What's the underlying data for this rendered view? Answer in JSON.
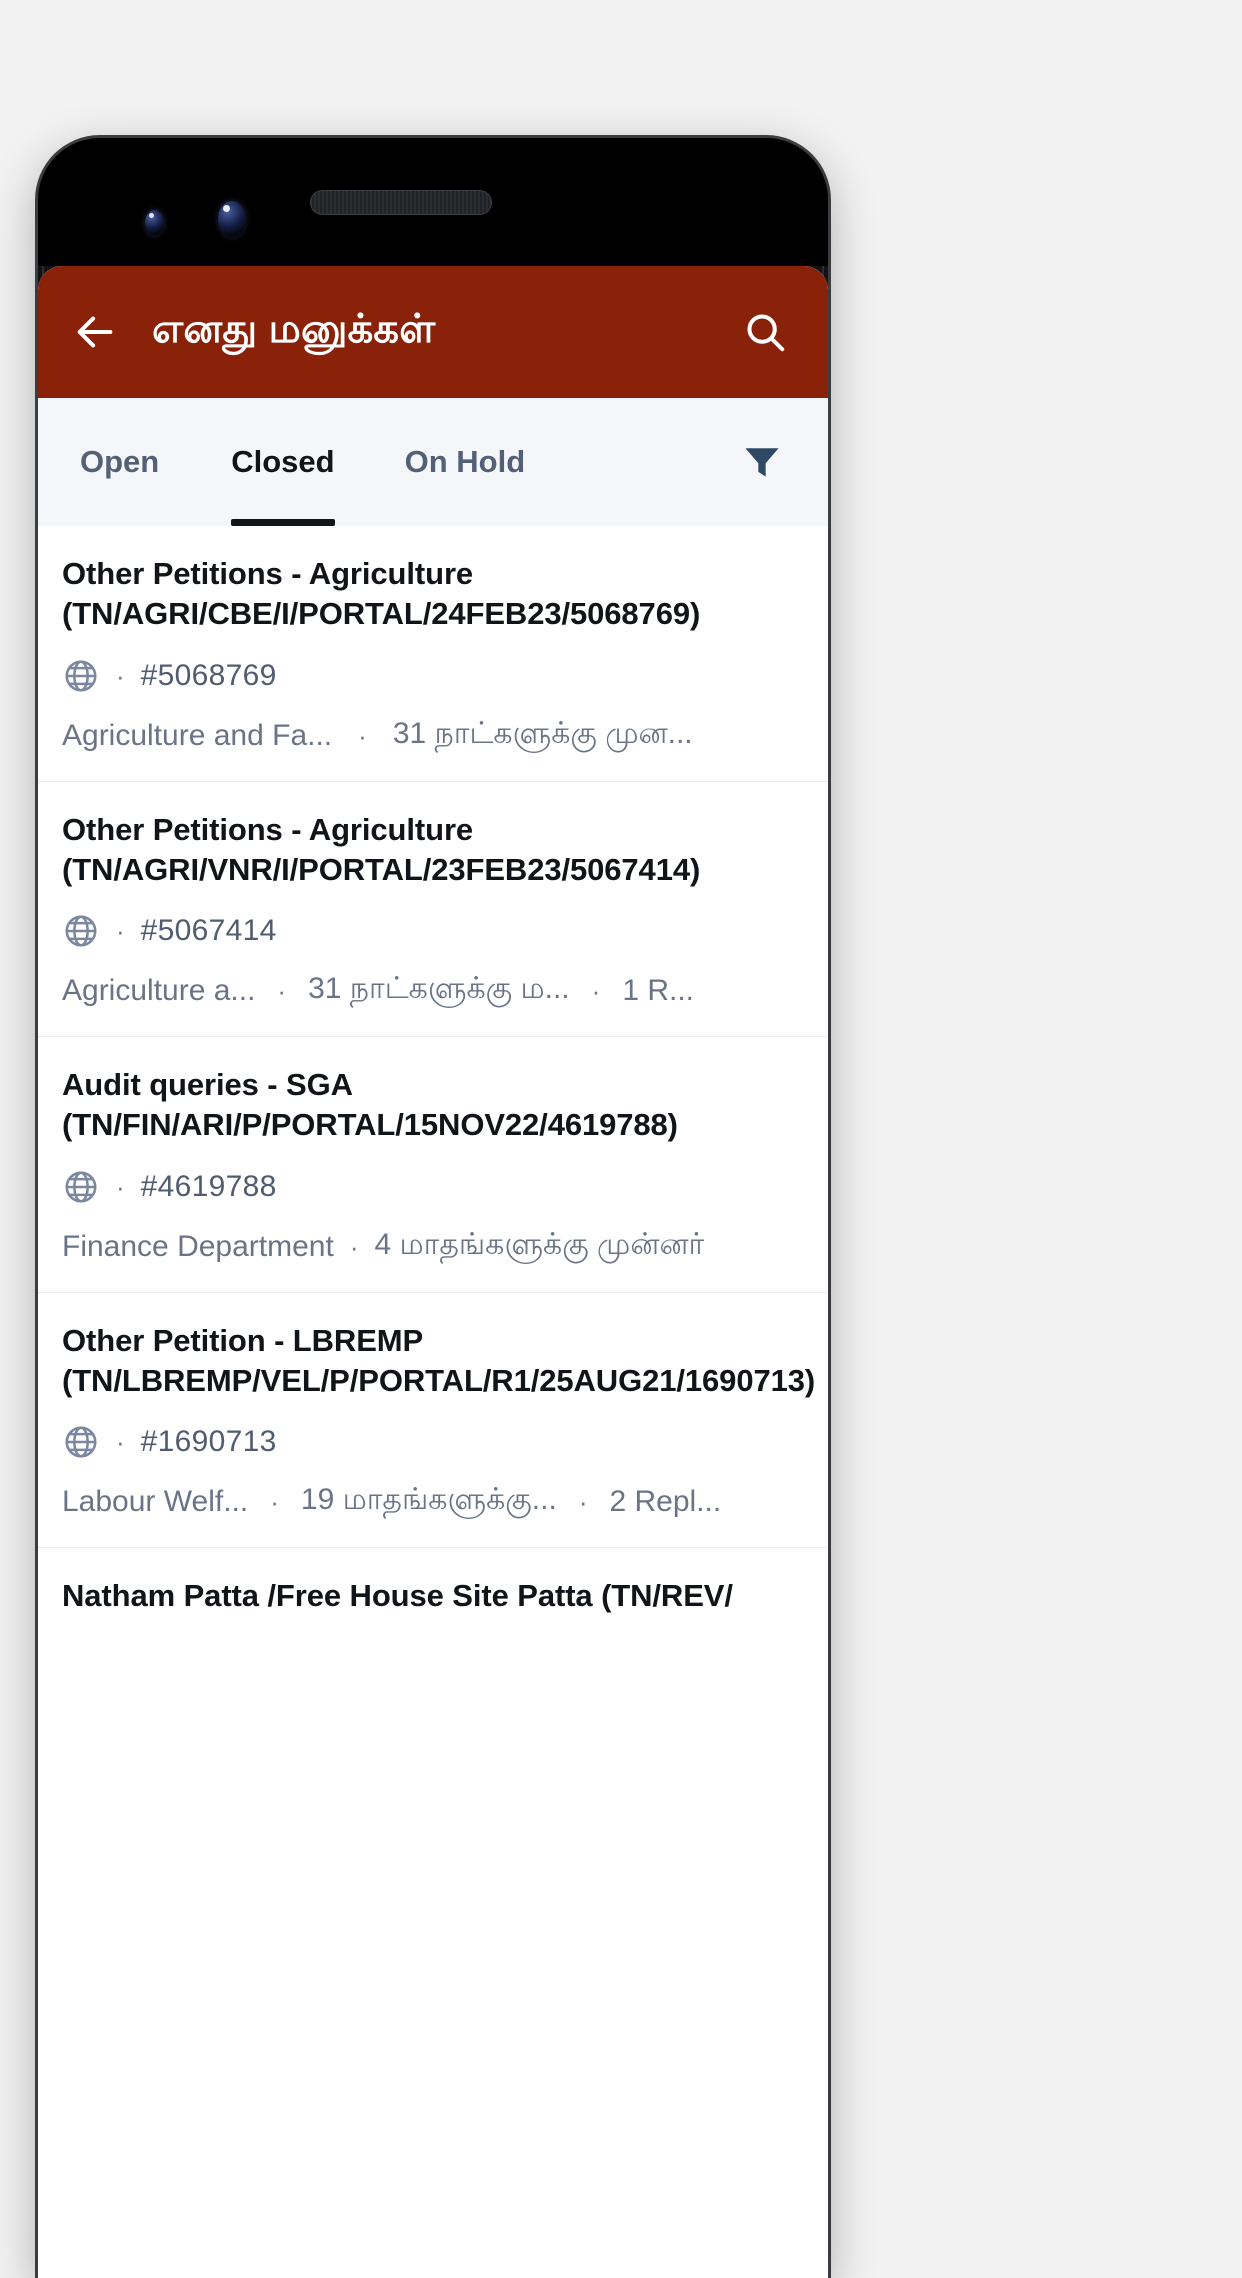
{
  "appbar": {
    "title": "எனது மனுக்கள்",
    "back_icon": "arrow-left-icon",
    "search_icon": "search-icon",
    "background": "#8a2109"
  },
  "tabs": {
    "items": [
      {
        "label": "Open",
        "active": false
      },
      {
        "label": "Closed",
        "active": true
      },
      {
        "label": "On Hold",
        "active": false
      }
    ],
    "filter_icon": "filter-funnel-icon",
    "filter_color": "#2f4864"
  },
  "list": {
    "items": [
      {
        "title": "Other Petitions - Agriculture (TN/AGRI/CBE/I/PORTAL/24FEB23/5068769)",
        "channel_icon": "globe-icon",
        "id": "#5068769",
        "department": "Agriculture and Fa...",
        "age": "31 நாட்களுக்கு முன...",
        "replies": ""
      },
      {
        "title": "Other Petitions - Agriculture (TN/AGRI/VNR/I/PORTAL/23FEB23/5067414)",
        "channel_icon": "globe-icon",
        "id": "#5067414",
        "department": "Agriculture a...",
        "age": "31 நாட்களுக்கு ம...",
        "replies": "1 R..."
      },
      {
        "title": "Audit queries - SGA (TN/FIN/ARI/P/PORTAL/15NOV22/4619788)",
        "channel_icon": "globe-icon",
        "id": "#4619788",
        "department": "Finance Department",
        "age": "4 மாதங்களுக்கு முன்னர்",
        "replies": ""
      },
      {
        "title": "Other Petition - LBREMP (TN/LBREMP/VEL/P/PORTAL/R1/25AUG21/1690713)",
        "channel_icon": "globe-icon",
        "id": "#1690713",
        "department": "Labour Welf...",
        "age": "19 மாதங்களுக்கு...",
        "replies": "2 Repl..."
      },
      {
        "title": "Natham Patta /Free House Site Patta (TN/REV/",
        "channel_icon": "globe-icon",
        "id": "",
        "department": "",
        "age": "",
        "replies": ""
      }
    ]
  },
  "separator": "·"
}
